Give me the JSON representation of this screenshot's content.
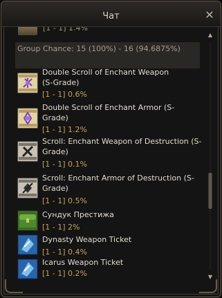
{
  "window": {
    "title": "Чат",
    "close_glyph": "✕",
    "close_icon": "close-icon"
  },
  "partial_row": {
    "text": "[1 - 1] 1.4%"
  },
  "group": {
    "text": "Group Chance: 15 (100%) - 16 (94.6875%)"
  },
  "items": [
    {
      "name": "Double Scroll of Enchant Weapon (S-Grade)",
      "meta": "[1 - 1] 0.6%",
      "icon": "enchant-weapon-scroll-icon"
    },
    {
      "name": "Double Scroll of Enchant Armor (S-Grade)",
      "meta": "[1 - 1] 1.2%",
      "icon": "enchant-armor-scroll-icon"
    },
    {
      "name": "Scroll: Enchant Weapon of Destruction (S-Grade)",
      "meta": "[1 - 1] 0.1%",
      "icon": "destruction-weapon-scroll-icon"
    },
    {
      "name": "Scroll: Enchant Armor of Destruction (S-Grade)",
      "meta": "[1 - 1] 0.5%",
      "icon": "destruction-armor-scroll-icon"
    },
    {
      "name": "Сундук Престижа",
      "meta": "[1 - 1] 2%",
      "icon": "green-chest-icon"
    },
    {
      "name": "Dynasty Weapon Ticket",
      "meta": "[1 - 1] 0.4%",
      "icon": "blue-ticket-icon"
    },
    {
      "name": "Icarus Weapon Ticket",
      "meta": "[1 - 1] 0.2%",
      "icon": "blue-ticket-icon"
    }
  ],
  "scrollbar": {
    "up_glyph": "▲",
    "down_glyph": "▼",
    "position_fraction": 0.62
  },
  "colors": {
    "title": "#d8d2c6",
    "item_name": "#e2dccf",
    "item_meta": "#c7a35a",
    "group_bg": "#2a2825"
  }
}
